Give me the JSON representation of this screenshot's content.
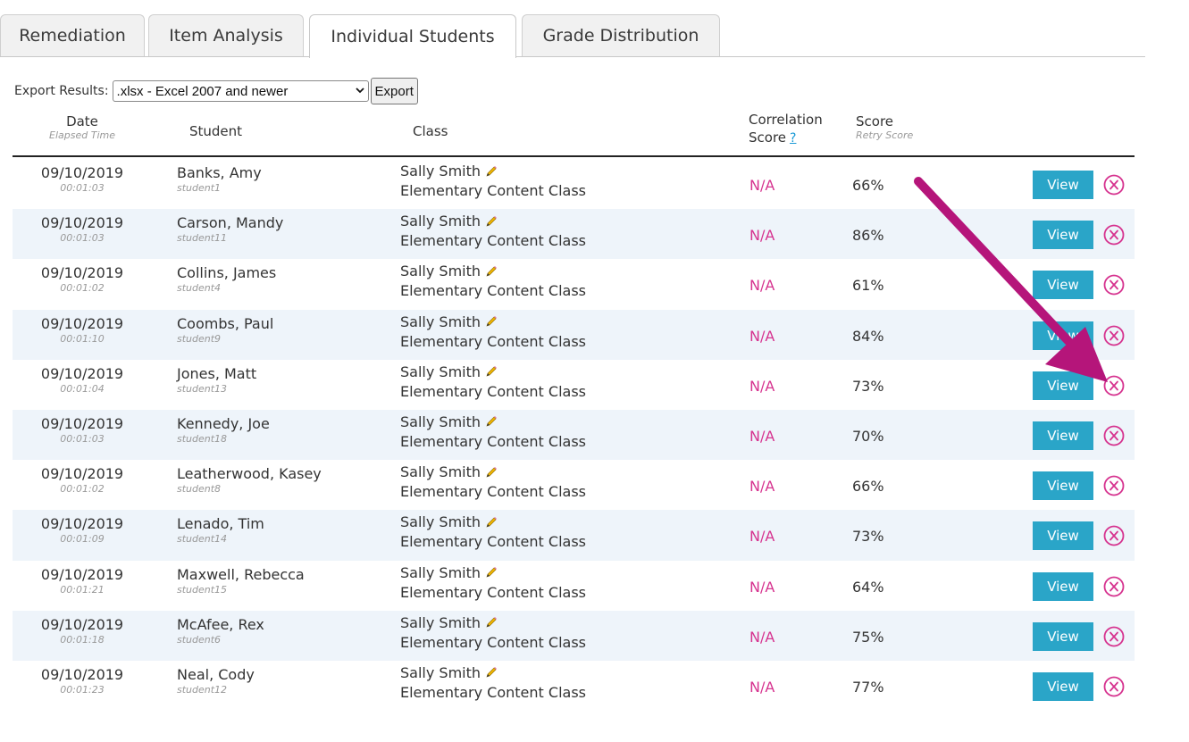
{
  "tabs": [
    {
      "label": "Remediation",
      "active": false
    },
    {
      "label": "Item Analysis",
      "active": false
    },
    {
      "label": "Individual Students",
      "active": true
    },
    {
      "label": "Grade Distribution",
      "active": false
    }
  ],
  "export": {
    "label": "Export Results:",
    "selected_format": ".xlsx - Excel 2007 and newer",
    "button_label": "Export"
  },
  "table": {
    "headers": {
      "date": "Date",
      "date_sub": "Elapsed Time",
      "student": "Student",
      "class": "Class",
      "correlation_line1": "Correlation",
      "correlation_line2": "Score",
      "correlation_help": "?",
      "score": "Score",
      "score_sub": "Retry Score"
    },
    "view_label": "View",
    "rows": [
      {
        "date": "09/10/2019",
        "time": "00:01:03",
        "name": "Banks, Amy",
        "id": "student1",
        "teacher": "Sally Smith",
        "class": "Elementary Content Class",
        "correlation": "N/A",
        "score": "66%"
      },
      {
        "date": "09/10/2019",
        "time": "00:01:03",
        "name": "Carson, Mandy",
        "id": "student11",
        "teacher": "Sally Smith",
        "class": "Elementary Content Class",
        "correlation": "N/A",
        "score": "86%"
      },
      {
        "date": "09/10/2019",
        "time": "00:01:02",
        "name": "Collins, James",
        "id": "student4",
        "teacher": "Sally Smith",
        "class": "Elementary Content Class",
        "correlation": "N/A",
        "score": "61%"
      },
      {
        "date": "09/10/2019",
        "time": "00:01:10",
        "name": "Coombs, Paul",
        "id": "student9",
        "teacher": "Sally Smith",
        "class": "Elementary Content Class",
        "correlation": "N/A",
        "score": "84%"
      },
      {
        "date": "09/10/2019",
        "time": "00:01:04",
        "name": "Jones, Matt",
        "id": "student13",
        "teacher": "Sally Smith",
        "class": "Elementary Content Class",
        "correlation": "N/A",
        "score": "73%"
      },
      {
        "date": "09/10/2019",
        "time": "00:01:03",
        "name": "Kennedy, Joe",
        "id": "student18",
        "teacher": "Sally Smith",
        "class": "Elementary Content Class",
        "correlation": "N/A",
        "score": "70%"
      },
      {
        "date": "09/10/2019",
        "time": "00:01:02",
        "name": "Leatherwood, Kasey",
        "id": "student8",
        "teacher": "Sally Smith",
        "class": "Elementary Content Class",
        "correlation": "N/A",
        "score": "66%"
      },
      {
        "date": "09/10/2019",
        "time": "00:01:09",
        "name": "Lenado, Tim",
        "id": "student14",
        "teacher": "Sally Smith",
        "class": "Elementary Content Class",
        "correlation": "N/A",
        "score": "73%"
      },
      {
        "date": "09/10/2019",
        "time": "00:01:21",
        "name": "Maxwell, Rebecca",
        "id": "student15",
        "teacher": "Sally Smith",
        "class": "Elementary Content Class",
        "correlation": "N/A",
        "score": "64%"
      },
      {
        "date": "09/10/2019",
        "time": "00:01:18",
        "name": "McAfee, Rex",
        "id": "student6",
        "teacher": "Sally Smith",
        "class": "Elementary Content Class",
        "correlation": "N/A",
        "score": "75%"
      },
      {
        "date": "09/10/2019",
        "time": "00:01:23",
        "name": "Neal, Cody",
        "id": "student12",
        "teacher": "Sally Smith",
        "class": "Elementary Content Class",
        "correlation": "N/A",
        "score": "77%"
      }
    ]
  },
  "colors": {
    "view_button": "#2aa5c8",
    "correlation_na": "#d6338f",
    "delete_icon": "#d6338f",
    "annotation_arrow": "#b5157a",
    "alt_row": "#eef4fa"
  },
  "icons": {
    "edit": "pencil-icon",
    "delete": "circle-x-icon",
    "dropdown": "chevron-down-icon"
  }
}
